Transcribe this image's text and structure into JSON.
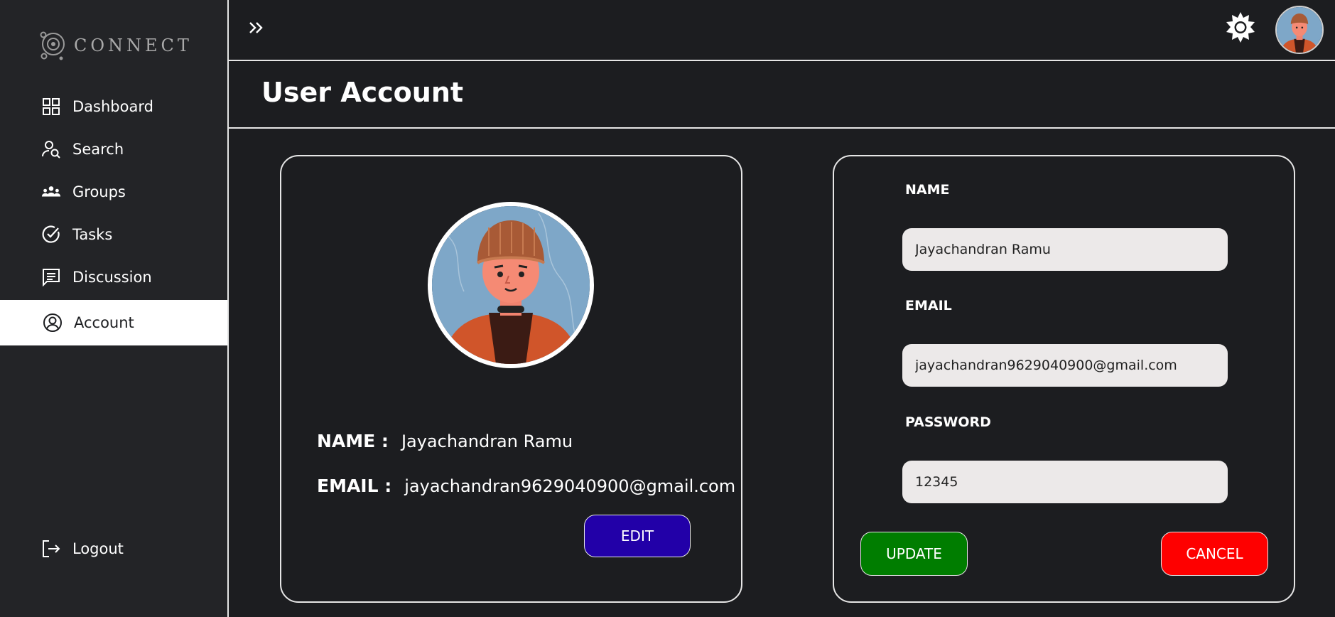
{
  "brand": {
    "name": "CONNECT",
    "icon": "connect-logo-icon"
  },
  "sidebar": {
    "items": [
      {
        "label": "Dashboard",
        "icon": "dashboard-grid-icon"
      },
      {
        "label": "Search",
        "icon": "user-search-icon"
      },
      {
        "label": "Groups",
        "icon": "groups-icon"
      },
      {
        "label": "Tasks",
        "icon": "check-circle-icon"
      },
      {
        "label": "Discussion",
        "icon": "chat-icon"
      },
      {
        "label": "Account",
        "icon": "user-circle-icon",
        "active": true
      }
    ],
    "logout_label": "Logout"
  },
  "topbar": {
    "expand_icon": "double-chevron-right-icon",
    "theme_icon": "sun-icon",
    "avatar_icon": "user-avatar"
  },
  "page": {
    "title": "User Account"
  },
  "profile": {
    "name_label": "NAME :",
    "name_value": "Jayachandran Ramu",
    "email_label": "EMAIL :",
    "email_value": "jayachandran9629040900@gmail.com",
    "edit_label": "EDIT"
  },
  "form": {
    "name_label": "NAME",
    "name_value": "Jayachandran Ramu",
    "email_label": "EMAIL",
    "email_value": "jayachandran9629040900@gmail.com",
    "password_label": "PASSWORD",
    "password_value": "12345",
    "update_label": "UPDATE",
    "cancel_label": "CANCEL"
  },
  "colors": {
    "background": "#1c1d20",
    "sidebar": "#232427",
    "edit_button": "#2200a8",
    "update_button": "#007d00",
    "cancel_button": "#fe0000",
    "input_bg": "#ece9e9"
  }
}
